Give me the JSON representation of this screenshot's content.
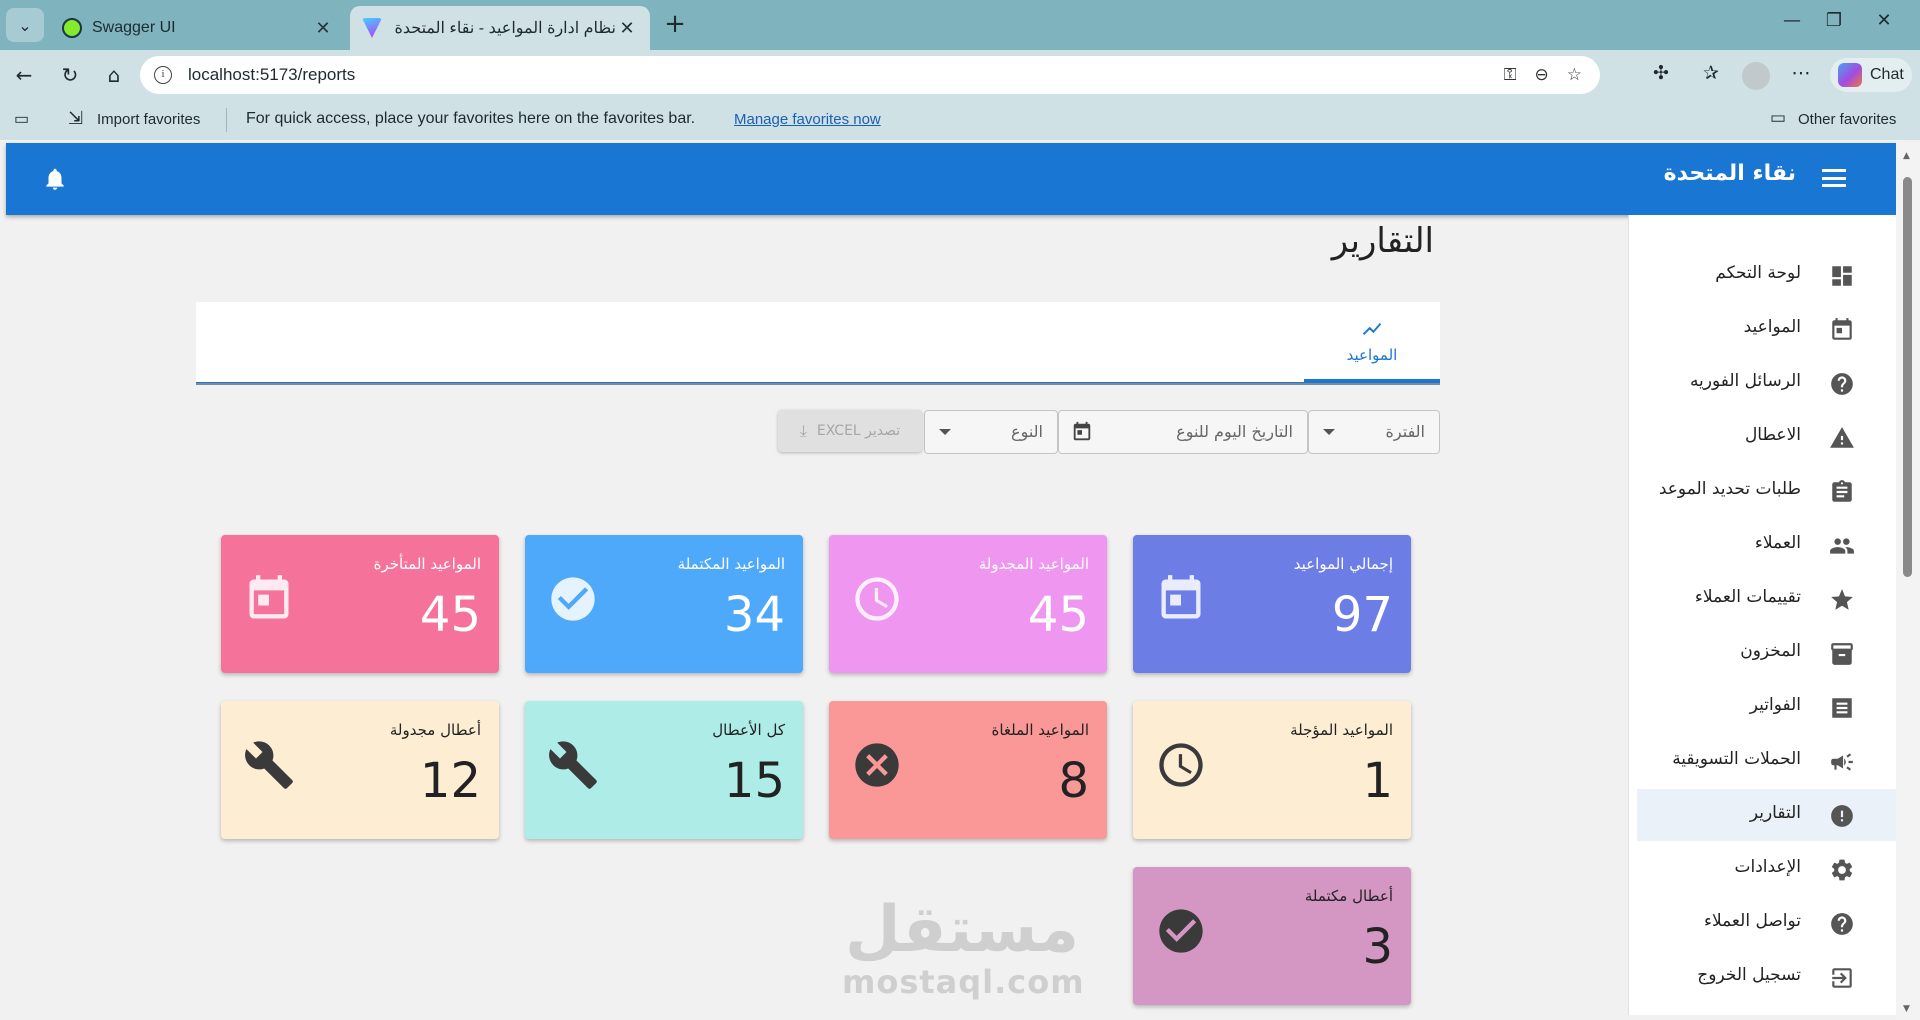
{
  "browser": {
    "tabs": [
      {
        "title": "Swagger UI",
        "favicon_color": "#85ea2d"
      },
      {
        "title": "نظام ادارة المواعيد - نقاء المتحدة",
        "favicon_color": "#a259ff"
      }
    ],
    "url": "localhost:5173/reports",
    "chat_label": "Chat",
    "favorites_bar": {
      "import_label": "Import favorites",
      "message": "For quick access, place your favorites here on the favorites bar.",
      "manage_link": "Manage favorites now",
      "other_label": "Other favorites"
    }
  },
  "appbar": {
    "title": "نقاء المتحدة",
    "color": "#1976d2"
  },
  "page": {
    "title": "التقارير",
    "tabs": [
      {
        "label": "المواعيد",
        "icon": "trending-chart-icon",
        "active": true
      }
    ]
  },
  "filters": {
    "period_label": "الفترة",
    "date_placeholder": "التاريخ اليوم للنوع",
    "type_label": "النوع",
    "export_label": "تصدير EXCEL"
  },
  "stats": [
    {
      "title": "إجمالي المواعيد",
      "value": "97",
      "icon": "calendar-icon",
      "bg": "#6c7ee6",
      "theme": "dark"
    },
    {
      "title": "المواعيد المجدولة",
      "value": "45",
      "icon": "clock-icon",
      "bg": "#ef96f0",
      "theme": "dark"
    },
    {
      "title": "المواعيد المكتملة",
      "value": "34",
      "icon": "check-circle-icon",
      "bg": "#4fa9fa",
      "theme": "dark"
    },
    {
      "title": "المواعيد المتأخرة",
      "value": "45",
      "icon": "calendar-icon",
      "bg": "#f5739a",
      "theme": "dark"
    },
    {
      "title": "المواعيد المؤجلة",
      "value": "1",
      "icon": "clock-icon",
      "bg": "#fdedd3",
      "theme": "light"
    },
    {
      "title": "المواعيد الملغاة",
      "value": "8",
      "icon": "cancel-icon",
      "bg": "#fa9897",
      "theme": "light"
    },
    {
      "title": "كل الأعطال",
      "value": "15",
      "icon": "wrench-icon",
      "bg": "#aeece8",
      "theme": "light"
    },
    {
      "title": "أعطال مجدولة",
      "value": "12",
      "icon": "wrench-icon",
      "bg": "#fdeed3",
      "theme": "light"
    },
    {
      "title": "أعطال مكتملة",
      "value": "3",
      "icon": "check-circle-icon",
      "bg": "#d497c4",
      "theme": "light"
    }
  ],
  "watermark": {
    "arabic": "مستقل",
    "latin": "mostaql.com"
  },
  "sidebar": {
    "items": [
      {
        "label": "لوحة التحكم",
        "icon": "dashboard-icon",
        "active": false
      },
      {
        "label": "المواعيد",
        "icon": "calendar-icon",
        "active": false
      },
      {
        "label": "الرسائل الفوريه",
        "icon": "help-icon",
        "active": false
      },
      {
        "label": "الاعطال",
        "icon": "warning-icon",
        "active": false
      },
      {
        "label": "طلبات تحديد الموعد",
        "icon": "clipboard-icon",
        "active": false
      },
      {
        "label": "العملاء",
        "icon": "people-icon",
        "active": false
      },
      {
        "label": "تقييمات العملاء",
        "icon": "star-icon",
        "active": false
      },
      {
        "label": "المخزون",
        "icon": "archive-icon",
        "active": false
      },
      {
        "label": "الفواتير",
        "icon": "receipt-icon",
        "active": false
      },
      {
        "label": "الحملات التسويقية",
        "icon": "megaphone-icon",
        "active": false
      },
      {
        "label": "التقارير",
        "icon": "report-icon",
        "active": true
      },
      {
        "label": "الإعدادات",
        "icon": "settings-icon",
        "active": false
      },
      {
        "label": "تواصل العملاء",
        "icon": "help-icon",
        "active": false
      },
      {
        "label": "تسجيل الخروج",
        "icon": "logout-icon",
        "active": false
      }
    ]
  }
}
